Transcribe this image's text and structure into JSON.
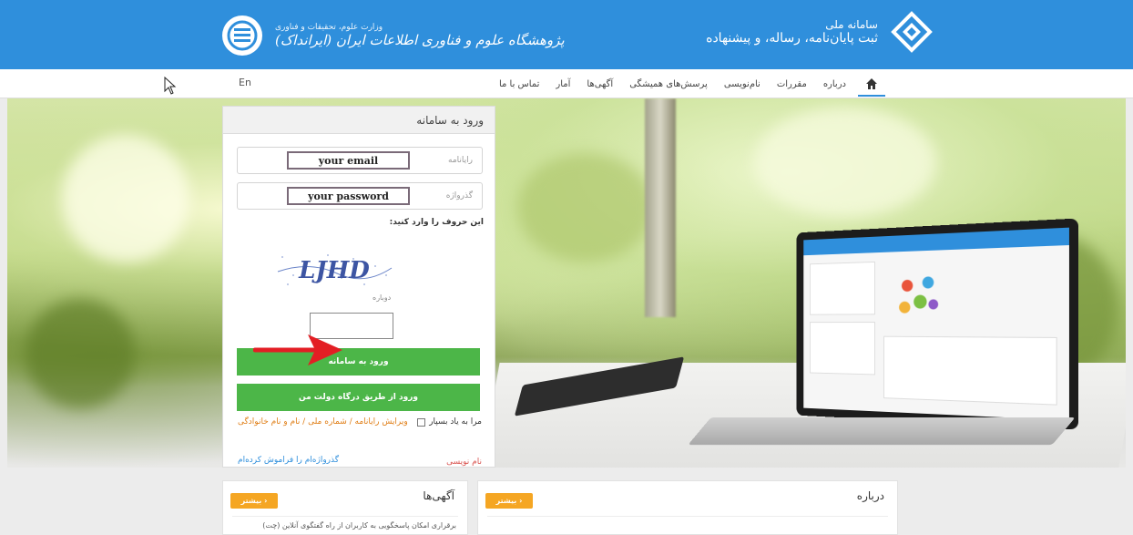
{
  "header": {
    "left_sub": "وزارت علوم، تحقیقات و فناوری",
    "left_main": "پژوهشگاه علوم و فناوری اطلاعات ایران (ایرانداک)",
    "right_sub": "سامانه ملی",
    "right_main": "ثبت پایان‌نامه، رساله، و پیشنهاده",
    "brand_color": "#2f8fdc"
  },
  "nav": {
    "lang": "En",
    "items": [
      "درباره",
      "مقررات",
      "نام‌نویسی",
      "پرسش‌های همیشگی",
      "آگهی‌ها",
      "آمار",
      "تماس با ما"
    ]
  },
  "login": {
    "title": "ورود به سامانه",
    "email_placeholder": "رایانامه",
    "email_value": "your email",
    "password_placeholder": "گذرواژه",
    "password_value": "your password",
    "captcha_label": "این حروف را وارد کنید:",
    "captcha_text": "LJHD",
    "refresh_label": "دوباره",
    "submit_label": "ورود به سامانه",
    "gov_login_label": "ورود از طریق درگاه دولت من",
    "remember_label": "مرا به یاد بسپار",
    "edit_link": "ویرایش رایانامه / شماره ملی / نام و نام خانوادگی",
    "register_link": "نام نویسی",
    "forgot_link": "گذرواژه‌ام را فراموش کرده‌ام",
    "button_color": "#4cb648"
  },
  "cards": {
    "about_title": "درباره",
    "ads_title": "آگهی‌ها",
    "more_label": "بیشتر ›",
    "ad_item": "برقراری امکان پاسخگویی به کاربران از راه گفتگوی آنلاین (چت)"
  }
}
